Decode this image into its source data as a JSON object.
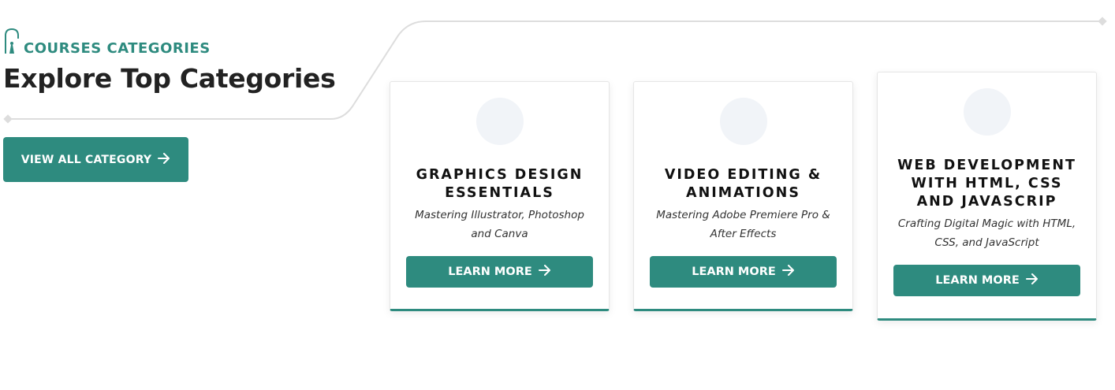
{
  "section": {
    "eyebrow": "COURSES CATEGORIES",
    "title": "Explore Top Categories",
    "cta_label": "VIEW ALL CATEGORY"
  },
  "cards": [
    {
      "title": "GRAPHICS DESIGN ESSENTIALS",
      "subtitle": "Mastering Illustrator, Photoshop and Canva",
      "button": "LEARN MORE"
    },
    {
      "title": "VIDEO EDITING & ANIMATIONS",
      "subtitle": "Mastering Adobe Premiere Pro & After Effects",
      "button": "LEARN MORE"
    },
    {
      "title": "WEB DEVELOPMENT WITH HTML, CSS AND JAVASCRIP",
      "subtitle": "Crafting Digital Magic with HTML, CSS, and JavaScript",
      "button": "LEARN MORE"
    }
  ],
  "colors": {
    "accent": "#2e8b7f",
    "icon_bg": "#f1f4f8",
    "text": "#222222"
  },
  "icons": {
    "eyebrow": "graduation-icon",
    "arrow": "arrow-right-icon"
  }
}
